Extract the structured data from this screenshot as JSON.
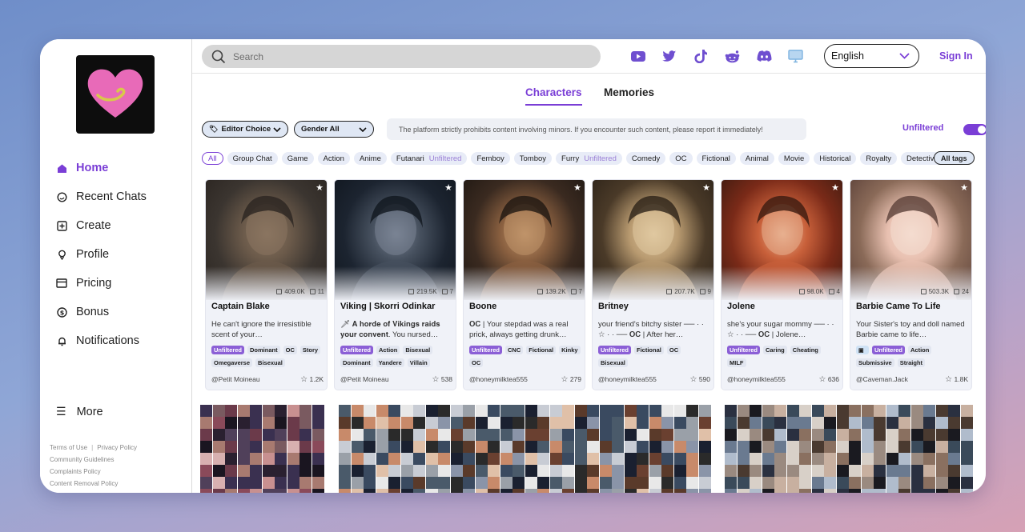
{
  "sidebar": {
    "nav": [
      {
        "label": "Home",
        "icon": "home-icon"
      },
      {
        "label": "Recent Chats",
        "icon": "chat-icon"
      },
      {
        "label": "Create",
        "icon": "plus-square-icon"
      },
      {
        "label": "Profile",
        "icon": "profile-icon"
      },
      {
        "label": "Pricing",
        "icon": "card-icon"
      },
      {
        "label": "Bonus",
        "icon": "dollar-icon"
      },
      {
        "label": "Notifications",
        "icon": "bell-icon"
      }
    ],
    "more": "More",
    "footer": {
      "terms": "Terms of Use",
      "privacy": "Privacy Policy",
      "community": "Community Guidelines",
      "complaints": "Complaints Policy",
      "removal": "Content Removal Policy"
    }
  },
  "topbar": {
    "search_placeholder": "Search",
    "language": "English",
    "signin": "Sign In",
    "social": [
      "youtube-icon",
      "twitter-icon",
      "tiktok-icon",
      "reddit-icon",
      "discord-icon",
      "desktop-icon"
    ]
  },
  "tabs": {
    "characters": "Characters",
    "memories": "Memories"
  },
  "filters": {
    "editor": "Editor Choice",
    "gender": "Gender All",
    "notice": "The platform strictly prohibits content involving minors. If you encounter such content, please report it immediately!",
    "unfiltered": "Unfiltered"
  },
  "tags": [
    {
      "label": "All"
    },
    {
      "label": "Group Chat"
    },
    {
      "label": "Game"
    },
    {
      "label": "Action"
    },
    {
      "label": "Anime"
    },
    {
      "label": "Futanari",
      "sub": "Unfiltered"
    },
    {
      "label": "Femboy"
    },
    {
      "label": "Tomboy"
    },
    {
      "label": "Furry",
      "sub": "Unfiltered"
    },
    {
      "label": "Comedy"
    },
    {
      "label": "OC"
    },
    {
      "label": "Fictional"
    },
    {
      "label": "Animal"
    },
    {
      "label": "Movie"
    },
    {
      "label": "Historical"
    },
    {
      "label": "Royalty"
    },
    {
      "label": "Detective"
    }
  ],
  "all_tags": "All tags",
  "cards": [
    {
      "name": "Captain Blake",
      "desc": "He can't ignore the irresistible scent of your…",
      "chats": "409.0K",
      "count": "11",
      "tags": [
        "Unfiltered",
        "Dominant",
        "OC",
        "Story",
        "Omegaverse",
        "Bisexual"
      ],
      "author": "@Petit Moineau",
      "likes": "1.2K",
      "palette": [
        "#3b3530",
        "#6b5a4a",
        "#2a2420",
        "#8a7560"
      ]
    },
    {
      "name": "Viking | Skorri Odinkar",
      "desc": "🗡 𝐀 𝐡𝐨𝐫𝐝𝐞 𝐨𝐟 𝐕𝐢𝐤𝐢𝐧𝐠𝐬 𝐫𝐚𝐢𝐝𝐬 𝐲𝐨𝐮𝐫 𝐜𝐨𝐧𝐯𝐞𝐧𝐭. You nursed…",
      "chats": "219.5K",
      "count": "7",
      "tags": [
        "Unfiltered",
        "Action",
        "Bisexual",
        "Dominant",
        "Yandere",
        "Villain"
      ],
      "author": "@Petit Moineau",
      "likes": "538",
      "palette": [
        "#1c2430",
        "#46505e",
        "#10161e",
        "#7a8494"
      ]
    },
    {
      "name": "Boone",
      "desc": "𝐎𝐂 | Your stepdad was a real prick, always getting drunk…",
      "chats": "139.2K",
      "count": "7",
      "tags": [
        "Unfiltered",
        "CNC",
        "Fictional",
        "Kinky",
        "OC"
      ],
      "author": "@honeymilktea555",
      "likes": "279",
      "palette": [
        "#3a2a20",
        "#8a6040",
        "#1e1712",
        "#c0946a"
      ]
    },
    {
      "name": "Britney",
      "desc": "your friend's bitchy sister ── · · ☆ · · ── 𝐎𝐂 | After her…",
      "chats": "207.7K",
      "count": "9",
      "tags": [
        "Unfiltered",
        "Fictional",
        "OC",
        "Bisexual"
      ],
      "author": "@honeymilktea555",
      "likes": "590",
      "palette": [
        "#4a3a28",
        "#b89a70",
        "#2c2218",
        "#e0c8a0"
      ]
    },
    {
      "name": "Jolene",
      "desc": "she's your sugar mommy ── · · ☆ · · ── 𝐎𝐂 | Jolene…",
      "chats": "98.0K",
      "count": "4",
      "tags": [
        "Unfiltered",
        "Caring",
        "Cheating",
        "MILF"
      ],
      "author": "@honeymilktea555",
      "likes": "636",
      "palette": [
        "#7a2a18",
        "#c8603a",
        "#3a1a10",
        "#e8b090"
      ]
    },
    {
      "name": "Barbie Came To Life",
      "desc": "Your Sister's toy and doll named Barbie came to life…",
      "chats": "503.3K",
      "count": "24",
      "tags": [
        "img",
        "Unfiltered",
        "Action",
        "Submissive",
        "Straight"
      ],
      "author": "@Caveman.Jack",
      "likes": "1.8K",
      "palette": [
        "#8a6a58",
        "#e8c0b0",
        "#5a4038",
        "#f4dcd0"
      ]
    }
  ]
}
